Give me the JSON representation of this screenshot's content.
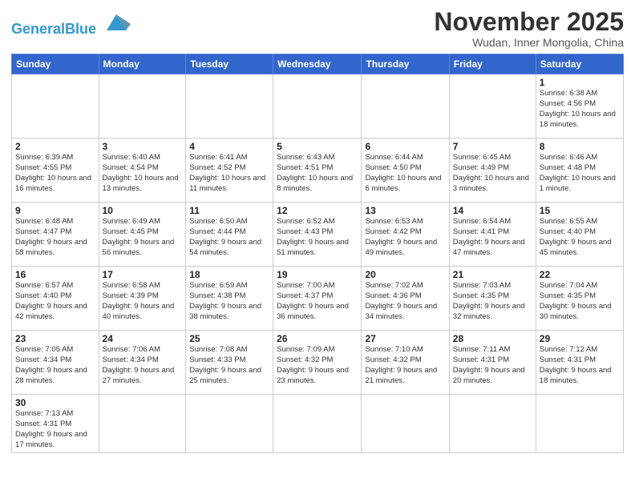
{
  "logo": {
    "text_general": "General",
    "text_blue": "Blue"
  },
  "title": "November 2025",
  "subtitle": "Wudan, Inner Mongolia, China",
  "weekdays": [
    "Sunday",
    "Monday",
    "Tuesday",
    "Wednesday",
    "Thursday",
    "Friday",
    "Saturday"
  ],
  "weeks": [
    [
      {
        "day": "",
        "info": ""
      },
      {
        "day": "",
        "info": ""
      },
      {
        "day": "",
        "info": ""
      },
      {
        "day": "",
        "info": ""
      },
      {
        "day": "",
        "info": ""
      },
      {
        "day": "",
        "info": ""
      },
      {
        "day": "1",
        "info": "Sunrise: 6:38 AM\nSunset: 4:56 PM\nDaylight: 10 hours and 18 minutes."
      }
    ],
    [
      {
        "day": "2",
        "info": "Sunrise: 6:39 AM\nSunset: 4:55 PM\nDaylight: 10 hours and 16 minutes."
      },
      {
        "day": "3",
        "info": "Sunrise: 6:40 AM\nSunset: 4:54 PM\nDaylight: 10 hours and 13 minutes."
      },
      {
        "day": "4",
        "info": "Sunrise: 6:41 AM\nSunset: 4:52 PM\nDaylight: 10 hours and 11 minutes."
      },
      {
        "day": "5",
        "info": "Sunrise: 6:43 AM\nSunset: 4:51 PM\nDaylight: 10 hours and 8 minutes."
      },
      {
        "day": "6",
        "info": "Sunrise: 6:44 AM\nSunset: 4:50 PM\nDaylight: 10 hours and 6 minutes."
      },
      {
        "day": "7",
        "info": "Sunrise: 6:45 AM\nSunset: 4:49 PM\nDaylight: 10 hours and 3 minutes."
      },
      {
        "day": "8",
        "info": "Sunrise: 6:46 AM\nSunset: 4:48 PM\nDaylight: 10 hours and 1 minute."
      }
    ],
    [
      {
        "day": "9",
        "info": "Sunrise: 6:48 AM\nSunset: 4:47 PM\nDaylight: 9 hours and 58 minutes."
      },
      {
        "day": "10",
        "info": "Sunrise: 6:49 AM\nSunset: 4:45 PM\nDaylight: 9 hours and 56 minutes."
      },
      {
        "day": "11",
        "info": "Sunrise: 6:50 AM\nSunset: 4:44 PM\nDaylight: 9 hours and 54 minutes."
      },
      {
        "day": "12",
        "info": "Sunrise: 6:52 AM\nSunset: 4:43 PM\nDaylight: 9 hours and 51 minutes."
      },
      {
        "day": "13",
        "info": "Sunrise: 6:53 AM\nSunset: 4:42 PM\nDaylight: 9 hours and 49 minutes."
      },
      {
        "day": "14",
        "info": "Sunrise: 6:54 AM\nSunset: 4:41 PM\nDaylight: 9 hours and 47 minutes."
      },
      {
        "day": "15",
        "info": "Sunrise: 6:55 AM\nSunset: 4:40 PM\nDaylight: 9 hours and 45 minutes."
      }
    ],
    [
      {
        "day": "16",
        "info": "Sunrise: 6:57 AM\nSunset: 4:40 PM\nDaylight: 9 hours and 42 minutes."
      },
      {
        "day": "17",
        "info": "Sunrise: 6:58 AM\nSunset: 4:39 PM\nDaylight: 9 hours and 40 minutes."
      },
      {
        "day": "18",
        "info": "Sunrise: 6:59 AM\nSunset: 4:38 PM\nDaylight: 9 hours and 38 minutes."
      },
      {
        "day": "19",
        "info": "Sunrise: 7:00 AM\nSunset: 4:37 PM\nDaylight: 9 hours and 36 minutes."
      },
      {
        "day": "20",
        "info": "Sunrise: 7:02 AM\nSunset: 4:36 PM\nDaylight: 9 hours and 34 minutes."
      },
      {
        "day": "21",
        "info": "Sunrise: 7:03 AM\nSunset: 4:35 PM\nDaylight: 9 hours and 32 minutes."
      },
      {
        "day": "22",
        "info": "Sunrise: 7:04 AM\nSunset: 4:35 PM\nDaylight: 9 hours and 30 minutes."
      }
    ],
    [
      {
        "day": "23",
        "info": "Sunrise: 7:05 AM\nSunset: 4:34 PM\nDaylight: 9 hours and 28 minutes."
      },
      {
        "day": "24",
        "info": "Sunrise: 7:06 AM\nSunset: 4:34 PM\nDaylight: 9 hours and 27 minutes."
      },
      {
        "day": "25",
        "info": "Sunrise: 7:08 AM\nSunset: 4:33 PM\nDaylight: 9 hours and 25 minutes."
      },
      {
        "day": "26",
        "info": "Sunrise: 7:09 AM\nSunset: 4:32 PM\nDaylight: 9 hours and 23 minutes."
      },
      {
        "day": "27",
        "info": "Sunrise: 7:10 AM\nSunset: 4:32 PM\nDaylight: 9 hours and 21 minutes."
      },
      {
        "day": "28",
        "info": "Sunrise: 7:11 AM\nSunset: 4:31 PM\nDaylight: 9 hours and 20 minutes."
      },
      {
        "day": "29",
        "info": "Sunrise: 7:12 AM\nSunset: 4:31 PM\nDaylight: 9 hours and 18 minutes."
      }
    ],
    [
      {
        "day": "30",
        "info": "Sunrise: 7:13 AM\nSunset: 4:31 PM\nDaylight: 9 hours and 17 minutes."
      },
      {
        "day": "",
        "info": ""
      },
      {
        "day": "",
        "info": ""
      },
      {
        "day": "",
        "info": ""
      },
      {
        "day": "",
        "info": ""
      },
      {
        "day": "",
        "info": ""
      },
      {
        "day": "",
        "info": ""
      }
    ]
  ]
}
